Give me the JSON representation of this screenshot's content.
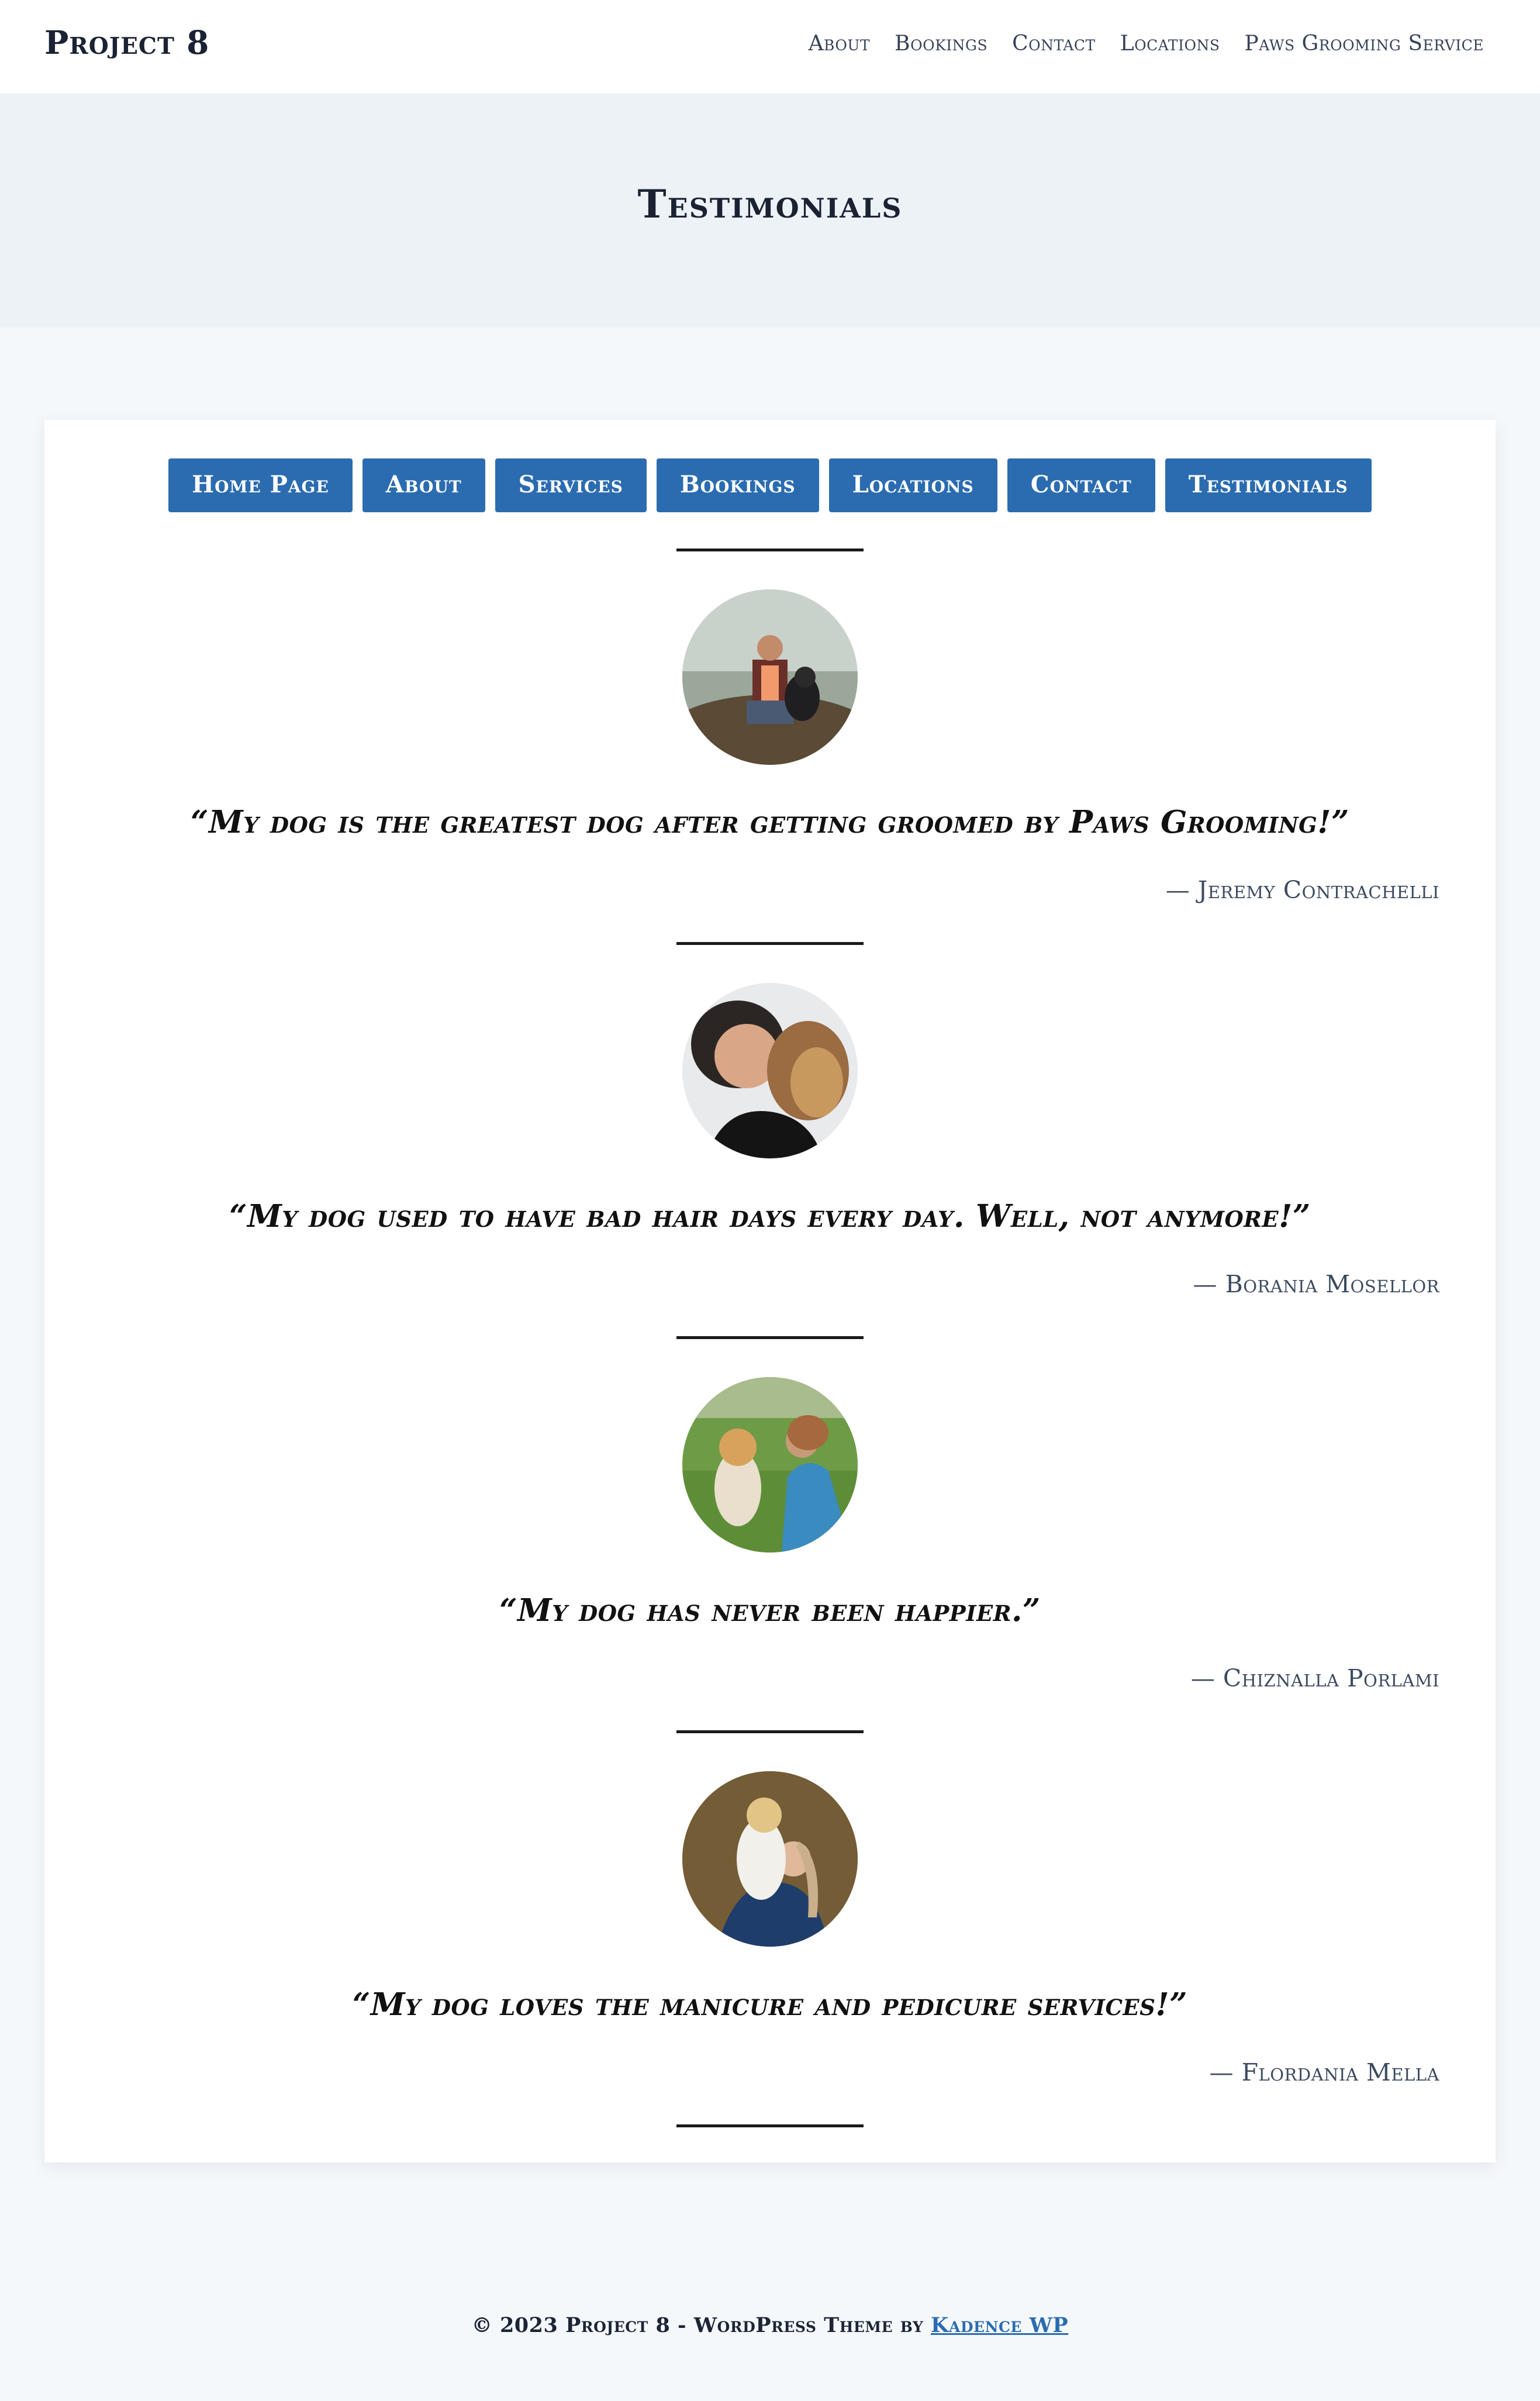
{
  "header": {
    "site_title": "Project 8",
    "nav": [
      "About",
      "Bookings",
      "Contact",
      "Locations",
      "Paws Grooming Service"
    ]
  },
  "hero": {
    "title": "Testimonials"
  },
  "buttons": [
    "Home Page",
    "About",
    "Services",
    "Bookings",
    "Locations",
    "Contact",
    "Testimonials"
  ],
  "testimonials": [
    {
      "quote": "“My dog is the greatest dog after getting groomed by Paws Grooming!”",
      "author": "— Jeremy Contrachelli"
    },
    {
      "quote": "“My dog used to have bad hair days every day. Well, not anymore!”",
      "author": "— Borania Mosellor"
    },
    {
      "quote": "“My dog has never been happier.”",
      "author": "— Chiznalla Porlami"
    },
    {
      "quote": "“My dog loves the manicure and pedicure services!”",
      "author": "— Flordania Mella"
    }
  ],
  "footer": {
    "text": "© 2023 Project 8 - WordPress Theme by",
    "link": "Kadence WP"
  },
  "colors": {
    "accent": "#2b6cb0",
    "hero_bg": "#edf2f7",
    "page_bg": "#f5f8fb"
  }
}
